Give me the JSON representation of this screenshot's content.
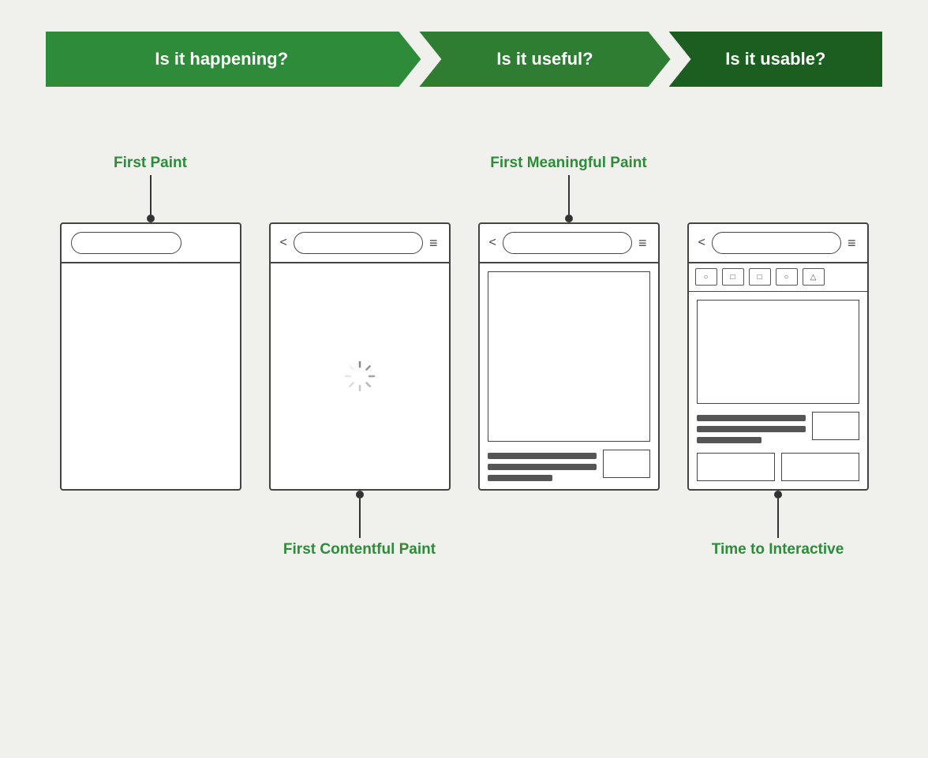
{
  "banner": {
    "items": [
      {
        "label": "Is it happening?",
        "color": "#2e8b3a"
      },
      {
        "label": "Is it useful?",
        "color": "#2e7d32"
      },
      {
        "label": "Is it usable?",
        "color": "#1b5e20"
      }
    ]
  },
  "phones": [
    {
      "id": "first-paint",
      "label_top": "First Paint",
      "label_bottom": "",
      "connector_top": true,
      "connector_bottom": false,
      "type": "blank"
    },
    {
      "id": "first-contentful-paint",
      "label_top": "",
      "label_bottom": "First Contentful Paint",
      "connector_top": false,
      "connector_bottom": true,
      "type": "loading"
    },
    {
      "id": "first-meaningful-paint",
      "label_top": "First Meaningful Paint",
      "label_bottom": "",
      "connector_top": true,
      "connector_bottom": false,
      "type": "content"
    },
    {
      "id": "time-to-interactive",
      "label_top": "",
      "label_bottom": "Time to Interactive",
      "connector_top": false,
      "connector_bottom": true,
      "type": "interactive"
    }
  ],
  "tab_symbols": [
    "○",
    "□",
    "□",
    "○",
    "△"
  ]
}
